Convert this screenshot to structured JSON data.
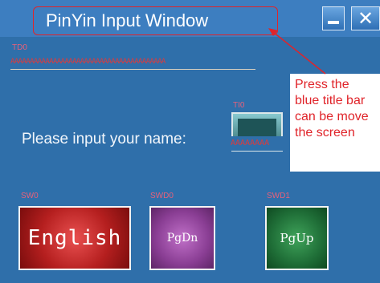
{
  "window": {
    "title": "PinYin Input Window",
    "close_glyph": "✕"
  },
  "labels": {
    "td0": "TD0",
    "ti0": "TI0",
    "sw0": "SW0",
    "swd0": "SWD0",
    "swd1": "SWD1"
  },
  "text_display": {
    "value": "AAAAAAAAAAAAAAAAAAAAAAAAAAAAAAAAAAAAAAAA"
  },
  "name_prompt": "Please input your name:",
  "name_input": {
    "value": "AAAAAAAA"
  },
  "buttons": {
    "english": "English",
    "pgdn": "PgDn",
    "pgup": "PgUp"
  },
  "annotation": {
    "lines": [
      "Press the",
      "blue title bar",
      "can be move",
      "the screen"
    ]
  },
  "colors": {
    "background": "#2f6faa",
    "title_bar": "#3d7ec0",
    "annotation_red": "#e0242a",
    "english_button": "#b51f1f",
    "pgdn_button": "#8a3e94",
    "pgup_button": "#1f6e37"
  },
  "icons": {
    "minimize": "minimize-icon",
    "close": "close-icon"
  }
}
